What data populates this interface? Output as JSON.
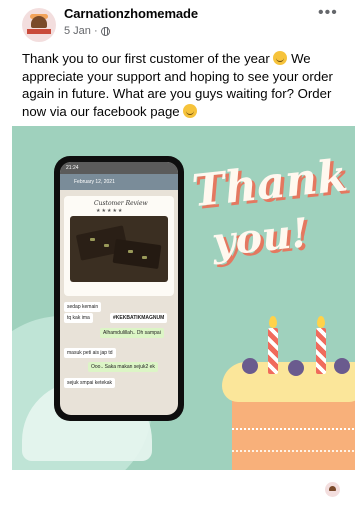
{
  "post": {
    "author": "Carnationzhomemade",
    "date": "5 Jan · ",
    "more_icon": "more-dots-icon",
    "privacy_icon": "globe-icon",
    "caption_part1": "Thank you to our first customer of the year ",
    "caption_part2": " We appreciate your support and hoping to see your order again in future. What are you guys waiting for? Order now via our facebook page ",
    "avatar_logo_text": "CARNATION HOMEMADE"
  },
  "image": {
    "thank_text": "Thank",
    "you_text": "you!",
    "phone": {
      "status_time": "21:24",
      "chat_date": "February 12, 2021",
      "review_title": "Customer Review",
      "messages": [
        {
          "text": "sedap kemain",
          "type": "in"
        },
        {
          "text": "tq kak ima",
          "type": "in"
        },
        {
          "text": "#KEKBATIKMAGNUM",
          "type": "in"
        },
        {
          "text": "Alhamdulillah.. Dh sampai",
          "type": "out"
        },
        {
          "text": "masuk peti ais jap td",
          "type": "in"
        },
        {
          "text": "Ooo.. Saka makan sejuk2 ek",
          "type": "out"
        },
        {
          "text": "sejuk smpai ketekak",
          "type": "in"
        }
      ]
    }
  },
  "colors": {
    "background_teal": "#9fd1bd",
    "accent_coral": "#e47860",
    "text_cream": "#fff8ef"
  }
}
